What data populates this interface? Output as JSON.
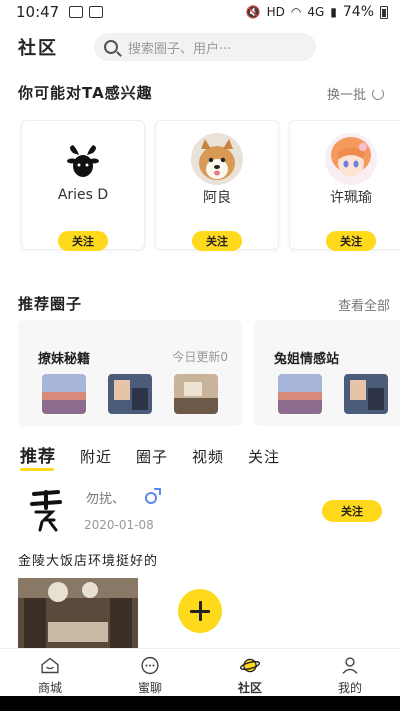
{
  "status_bar": {
    "time": "10:47",
    "network": "HD",
    "cell": "4G",
    "battery": "74%"
  },
  "header": {
    "title": "社区",
    "search_placeholder": "搜索圈子、用户···"
  },
  "interest": {
    "title": "你可能对TA感兴趣",
    "action": "换一批",
    "users": [
      {
        "name": "Aries D",
        "follow": "关注"
      },
      {
        "name": "阿良",
        "follow": "关注"
      },
      {
        "name": "许珮瑜",
        "follow": "关注"
      }
    ]
  },
  "circles": {
    "title": "推荐圈子",
    "action": "查看全部",
    "items": [
      {
        "name": "撩妹秘籍",
        "update": "今日更新0"
      },
      {
        "name": "兔姐情感站"
      }
    ]
  },
  "tabs": [
    "推荐",
    "附近",
    "圈子",
    "视频",
    "关注"
  ],
  "post": {
    "user": "勿扰、",
    "date": "2020-01-08",
    "follow": "关注",
    "text": "金陵大饭店环境挺好的",
    "avatar_text": "干就完"
  },
  "bottom_nav": [
    {
      "label": "商城",
      "icon": "home-icon"
    },
    {
      "label": "蜜聊",
      "icon": "chat-icon"
    },
    {
      "label": "社区",
      "icon": "planet-icon"
    },
    {
      "label": "我的",
      "icon": "profile-icon"
    }
  ],
  "colors": {
    "accent": "#ffd91c",
    "male": "#5b8be8"
  }
}
